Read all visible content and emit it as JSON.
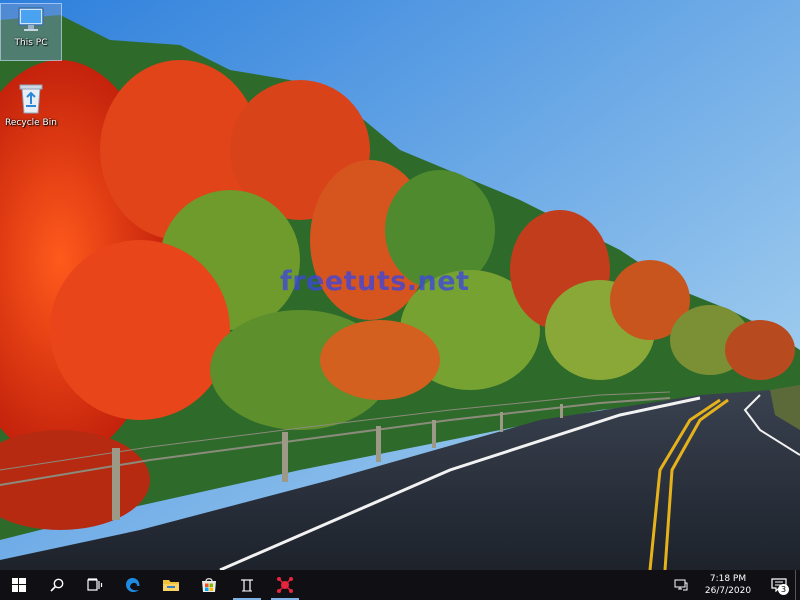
{
  "desktop": {
    "icons": [
      {
        "label": "This PC",
        "icon": "this-pc-icon",
        "selected": true
      },
      {
        "label": "Recycle Bin",
        "icon": "recycle-bin-icon",
        "selected": false
      }
    ],
    "watermark": "freetuts.net"
  },
  "taskbar": {
    "buttons": [
      {
        "name": "start",
        "icon": "windows-logo-icon"
      },
      {
        "name": "search",
        "icon": "search-icon"
      },
      {
        "name": "task-view",
        "icon": "task-view-icon"
      },
      {
        "name": "edge",
        "icon": "edge-icon"
      },
      {
        "name": "file-explorer",
        "icon": "folder-icon"
      },
      {
        "name": "store",
        "icon": "store-icon"
      },
      {
        "name": "app",
        "icon": "app-icon",
        "running": true
      },
      {
        "name": "pinned-app",
        "icon": "network-app-icon",
        "running": true
      }
    ],
    "tray": {
      "network_icon": "network-icon",
      "time": "7:18 PM",
      "date": "26/7/2020",
      "notification_count": "3"
    }
  },
  "colors": {
    "taskbar_bg": "#0f0f14",
    "accent": "#7fb3e6",
    "sky_top": "#3f8fe0",
    "sky_bottom": "#a9d3f0"
  }
}
